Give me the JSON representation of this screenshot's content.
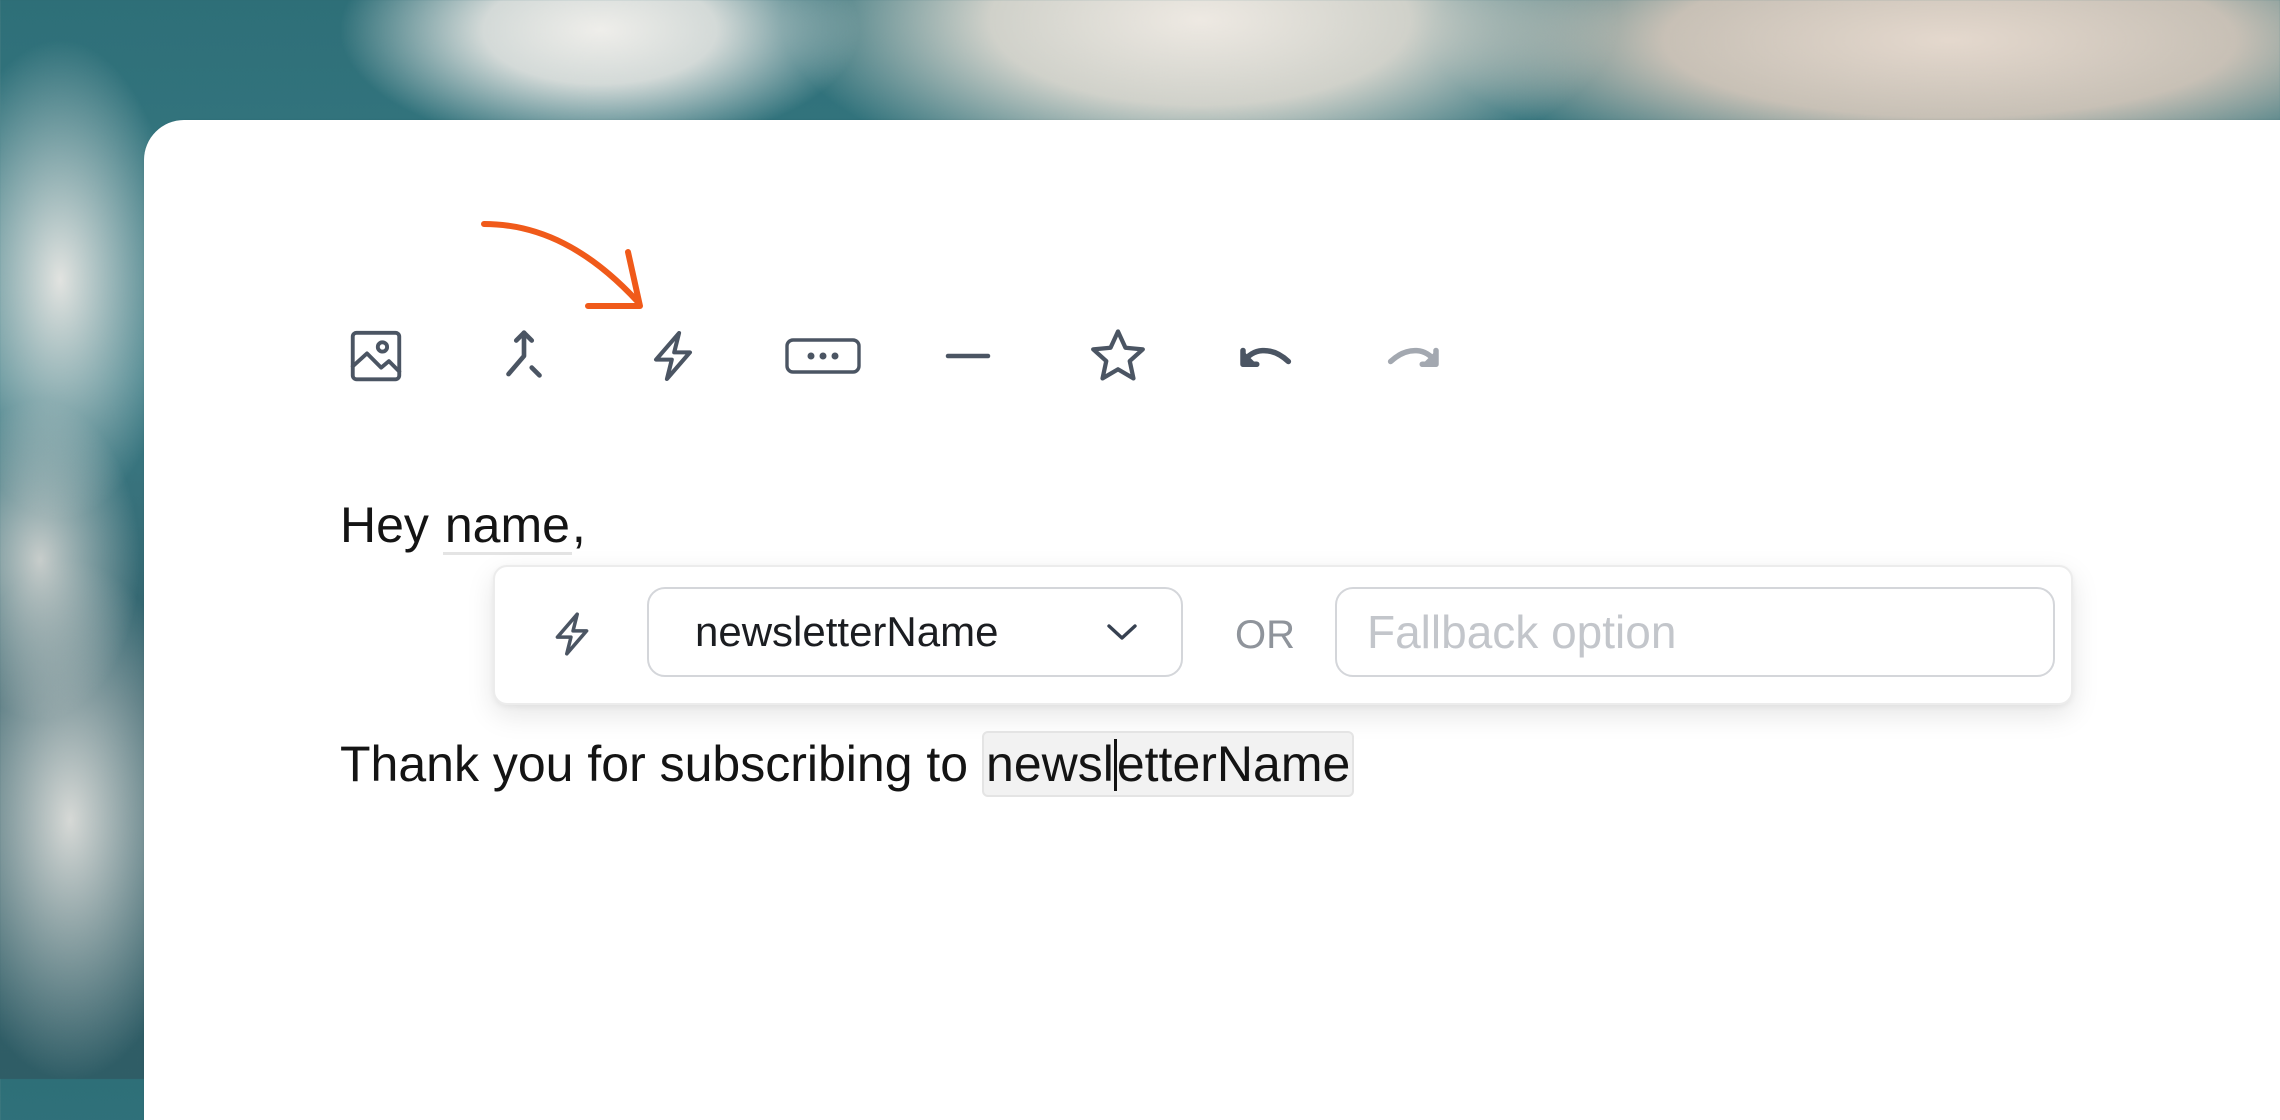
{
  "toolbar": {
    "icons": [
      "image-icon",
      "merge-icon",
      "lightning-icon",
      "button-icon",
      "divider-icon",
      "star-icon",
      "undo-icon",
      "redo-icon"
    ]
  },
  "annotation": {
    "color": "#f05a1a"
  },
  "editor": {
    "greeting_prefix": "Hey",
    "greeting_variable": "name",
    "greeting_suffix": ",",
    "body_prefix": "Thank you for subscribing to",
    "body_variable_before_caret": "newsl",
    "body_variable_after_caret": "etterName"
  },
  "popover": {
    "variable_select_value": "newsletterName",
    "or_label": "OR",
    "fallback_placeholder": "Fallback option",
    "fallback_value": ""
  },
  "colors": {
    "icon": "#4b5563",
    "icon_disabled": "#a3a8b0",
    "text": "#141414",
    "accent": "#f05a1a"
  }
}
